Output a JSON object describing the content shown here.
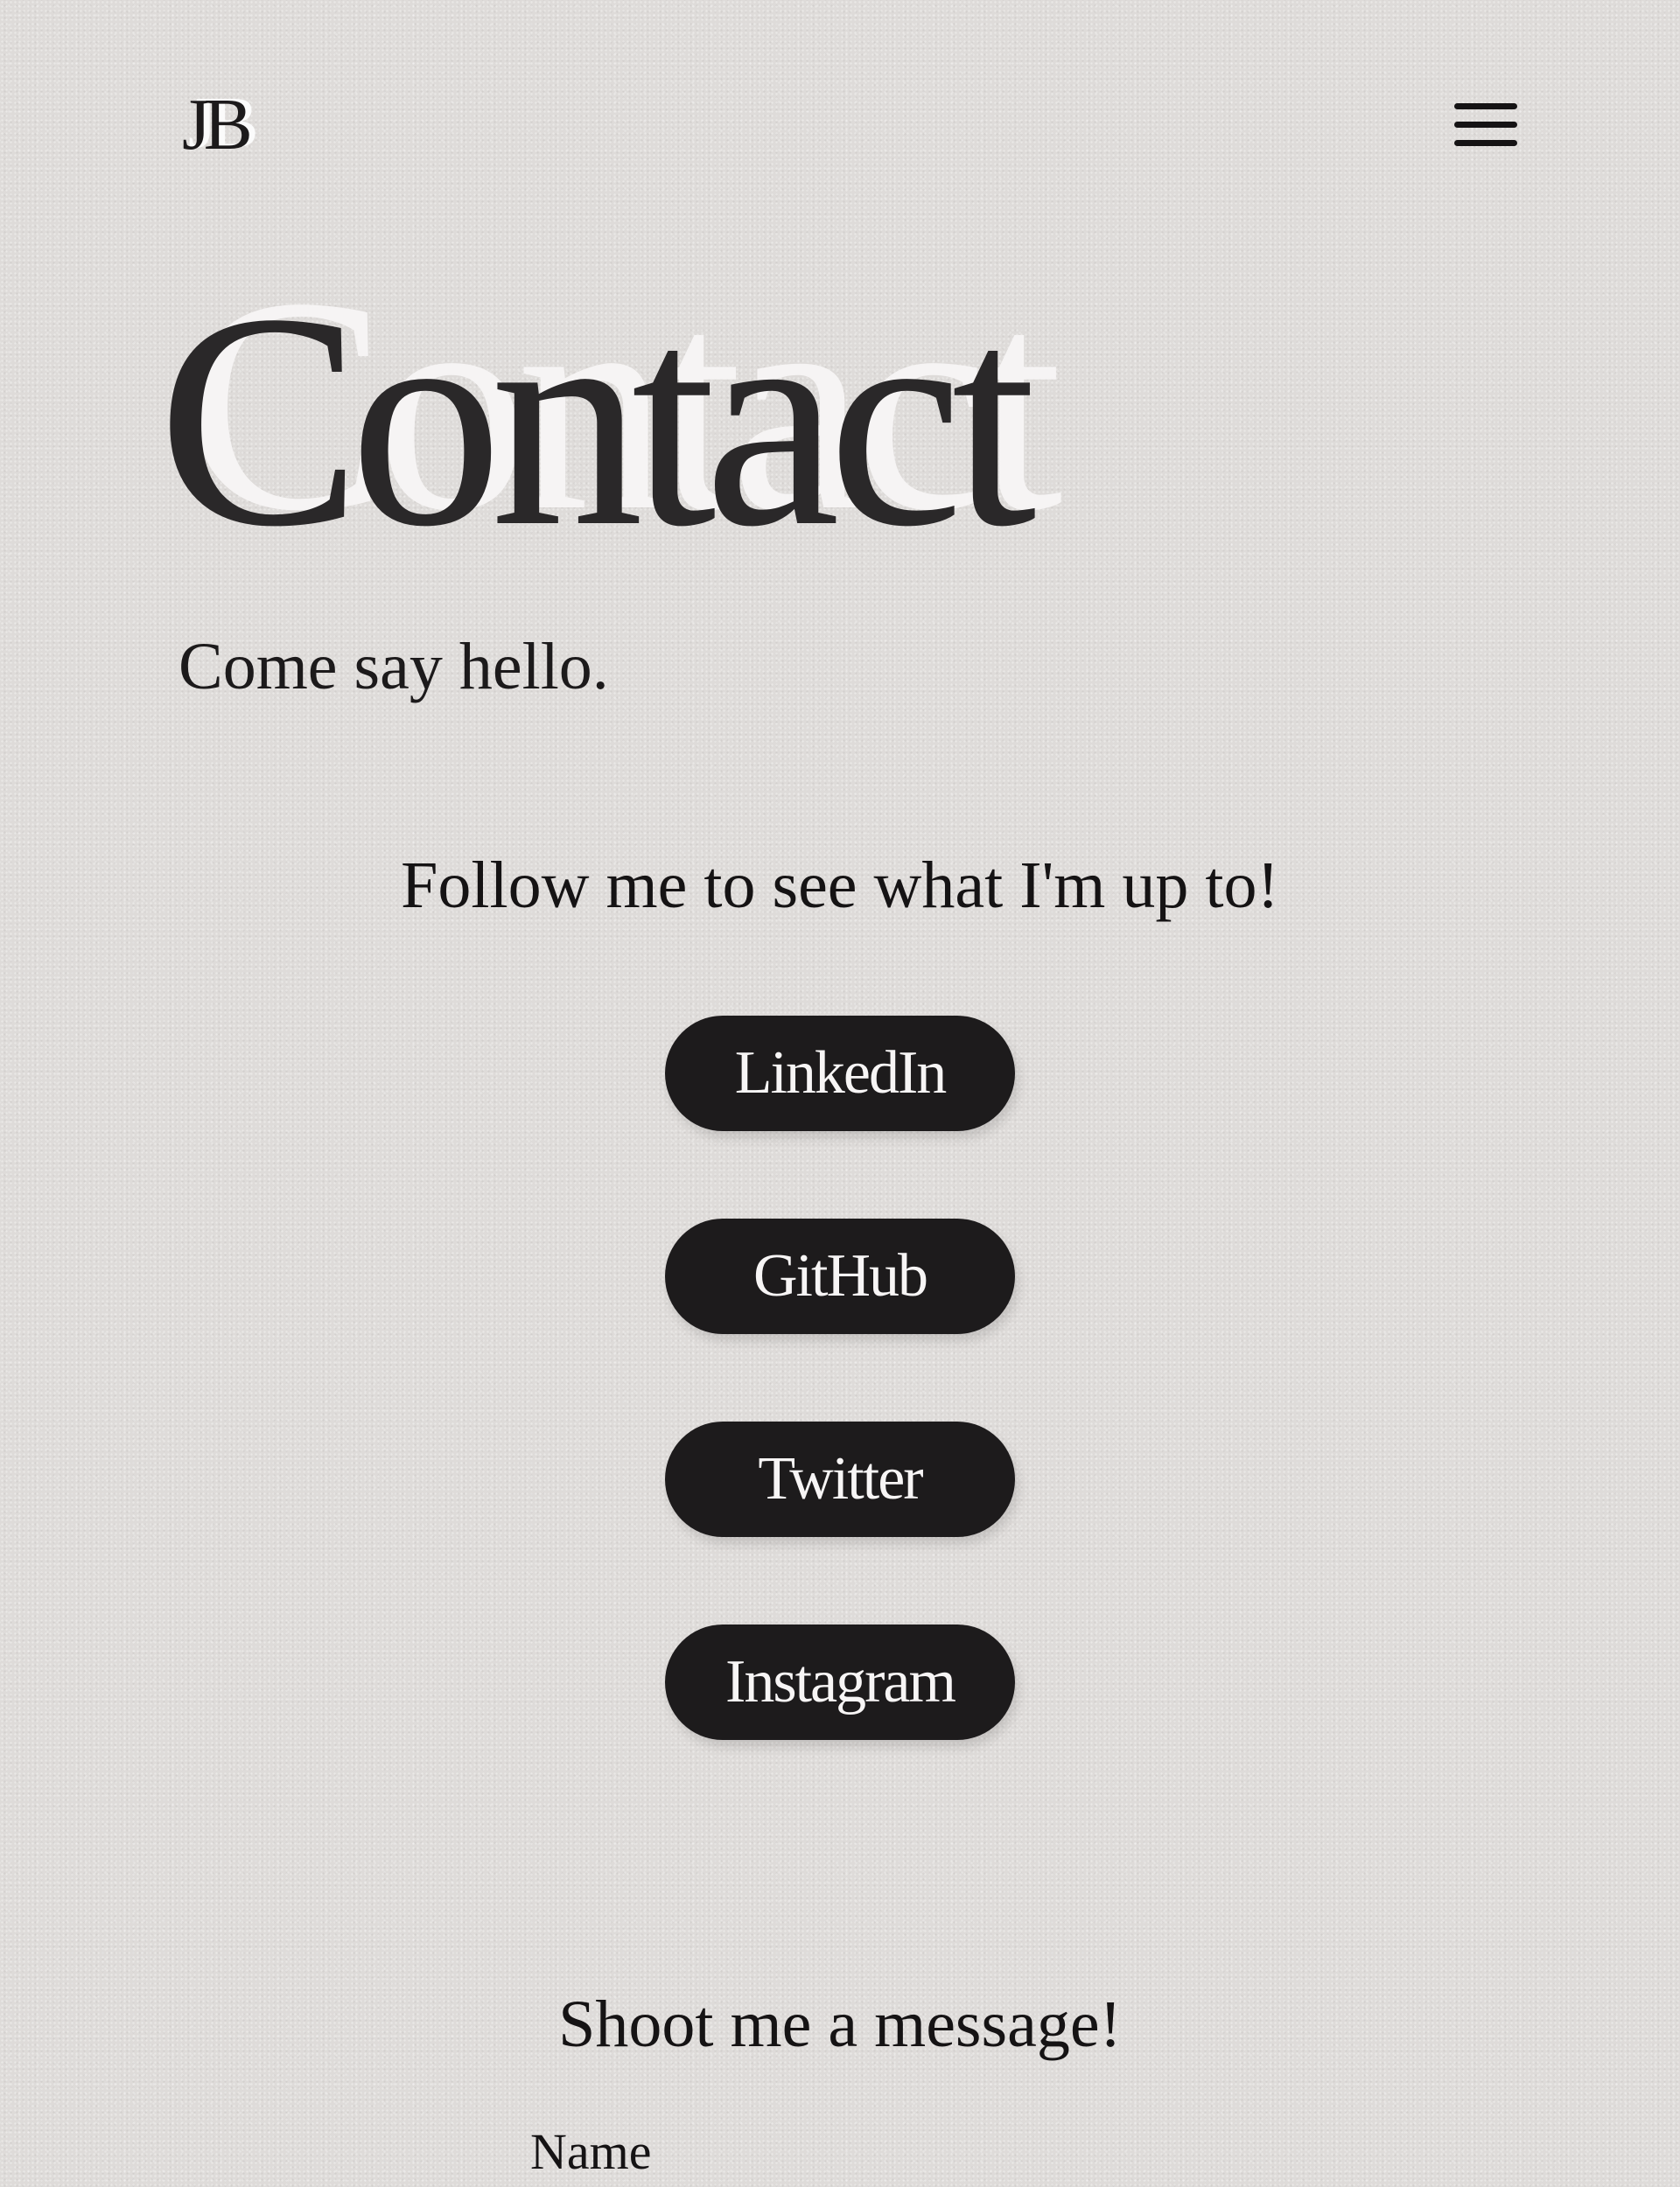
{
  "header": {
    "logo_text": "JB",
    "menu_icon": "hamburger-menu-icon"
  },
  "hero": {
    "title": "Contact",
    "subtitle": "Come say hello."
  },
  "social": {
    "heading": "Follow me to see what I'm up to!",
    "links": [
      {
        "label": "LinkedIn"
      },
      {
        "label": "GitHub"
      },
      {
        "label": "Twitter"
      },
      {
        "label": "Instagram"
      }
    ]
  },
  "message": {
    "heading": "Shoot me a message!",
    "name_label": "Name"
  },
  "colors": {
    "background": "#dedbd9",
    "text": "#1c1a1b",
    "button_bg": "#1d1b1c",
    "button_text": "#f7f5f5",
    "shadow_text": "#f6f4f4"
  }
}
